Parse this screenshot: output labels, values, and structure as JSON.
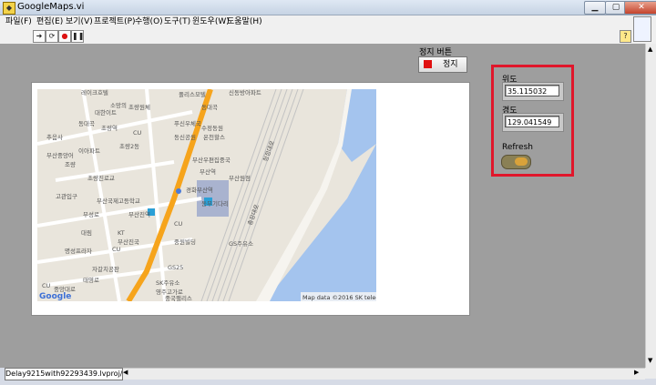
{
  "window": {
    "title": "GoogleMaps.vi",
    "min": "▁",
    "max": "▢",
    "close": "✕"
  },
  "menu": [
    {
      "label": "파일(F)"
    },
    {
      "label": "편집(E)"
    },
    {
      "label": "보기(V)"
    },
    {
      "label": "프로젝트(P)"
    },
    {
      "label": "수행(O)"
    },
    {
      "label": "도구(T)"
    },
    {
      "label": "윈도우(W)"
    },
    {
      "label": "도움말(H)"
    }
  ],
  "toolbar": {
    "run_arrow": "➜",
    "run_cont": "⟳",
    "abort": "●",
    "pause": "❚❚"
  },
  "stop": {
    "caption": "정지 버튼",
    "label": "정지"
  },
  "lat": {
    "label": "위도",
    "value": "35.115032"
  },
  "lng": {
    "label": "경도",
    "value": "129.041549"
  },
  "refresh": {
    "label": "Refresh"
  },
  "status": {
    "path": "Delay9215with92293439.lvproj/내 컴퓨터"
  },
  "map": {
    "copyright": "Map data ©2016 SK telecom",
    "logo": "Google",
    "labels": [
      "레이크호텔",
      "폴리스모텔",
      "신동방아파트",
      "대한이트",
      "소망의",
      "초량원체",
      "동대곡",
      "동대곡",
      "초량역",
      "푸신우체국",
      "추음사",
      "동신공원",
      "수정동원",
      "온천할스",
      "부산중앙어",
      "부산역",
      "경화부산역",
      "초량진로교",
      "이아파트",
      "조량",
      "고관입구",
      "중앙대로",
      "태영로",
      "부성로",
      "초량2동",
      "영주고가로",
      "부산국제고등학교",
      "대림",
      "KT",
      "부산진역",
      "부산진국",
      "동부기다리",
      "자갈치공판",
      "CU",
      "CU",
      "CU",
      "CU",
      "GS25",
      "SK주유소",
      "중국팰리스",
      "명성프라자",
      "청정대로",
      "충장대로",
      "부산원점",
      "GS주유소",
      "중원빌딩",
      "부산우편집중국"
    ],
    "colors": {
      "land": "#e9e5dc",
      "water": "#a4c4ee",
      "road_major": "#f6a41c",
      "rail": "#c3c3c3"
    }
  }
}
